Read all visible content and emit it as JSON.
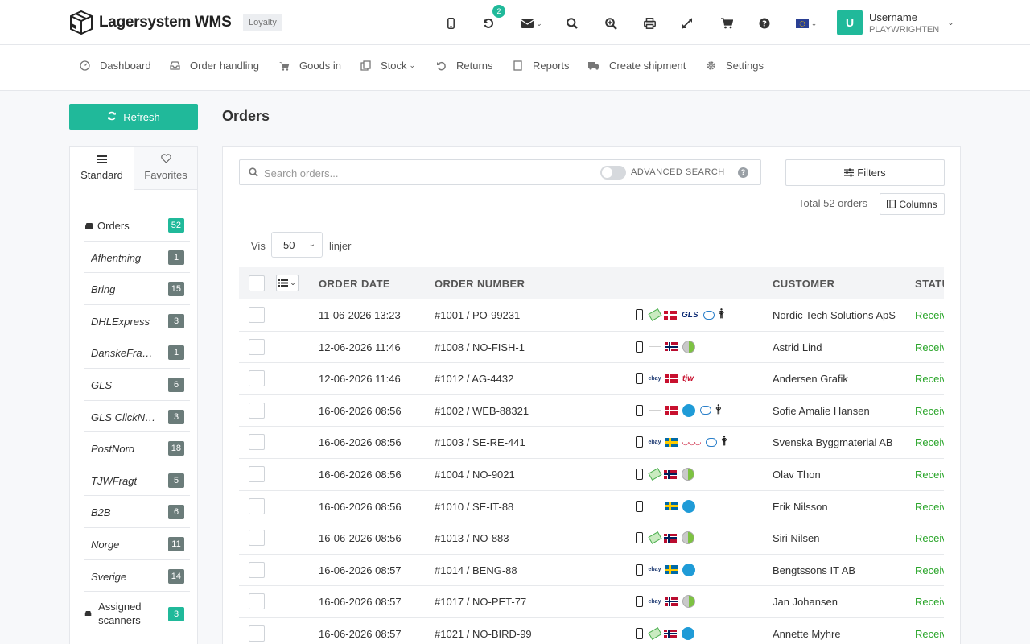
{
  "app": {
    "name": "Lagersystem WMS",
    "badge": "Loyalty"
  },
  "topbar": {
    "notification_count": "2",
    "user": {
      "initial": "U",
      "name": "Username",
      "account": "PLAYWRIGHTEN"
    }
  },
  "nav": [
    {
      "label": "Dashboard",
      "icon": "dashboard-icon"
    },
    {
      "label": "Order handling",
      "icon": "inbox-icon"
    },
    {
      "label": "Goods in",
      "icon": "cart-icon"
    },
    {
      "label": "Stock",
      "icon": "copy-icon"
    },
    {
      "label": "Returns",
      "icon": "undo-icon"
    },
    {
      "label": "Reports",
      "icon": "file-icon"
    },
    {
      "label": "Create shipment",
      "icon": "truck-icon"
    },
    {
      "label": "Settings",
      "icon": "gear-icon"
    }
  ],
  "sidebar": {
    "refresh_label": "Refresh",
    "tabs": {
      "standard": "Standard",
      "favorites": "Favorites"
    },
    "orders": {
      "label": "Orders",
      "count": "52"
    },
    "items": [
      {
        "label": "Afhentning",
        "count": "1"
      },
      {
        "label": "Bring",
        "count": "15"
      },
      {
        "label": "DHLExpress",
        "count": "3"
      },
      {
        "label": "DanskeFragtmænd",
        "count": "1"
      },
      {
        "label": "GLS",
        "count": "6"
      },
      {
        "label": "GLS ClickNShip",
        "count": "3"
      },
      {
        "label": "PostNord",
        "count": "18"
      },
      {
        "label": "TJWFragt",
        "count": "5"
      },
      {
        "label": "B2B",
        "count": "6"
      },
      {
        "label": "Norge",
        "count": "11"
      },
      {
        "label": "Sverige",
        "count": "14"
      }
    ],
    "assigned": {
      "label": "Assigned scanners",
      "count": "3"
    }
  },
  "main": {
    "title": "Orders",
    "search_placeholder": "Search orders...",
    "advanced_search": "ADVANCED SEARCH",
    "help": "?",
    "filters_label": "Filters",
    "total": "Total 52 orders",
    "columns_label": "Columns",
    "vis": "Vis",
    "per_page": "50",
    "linjer": "linjer"
  },
  "table": {
    "headers": {
      "date": "ORDER DATE",
      "number": "ORDER NUMBER",
      "customer": "CUSTOMER",
      "status": "STATUS"
    },
    "rows": [
      {
        "date": "11-06-2026 13:23",
        "number": "#1001 / PO-99231",
        "customer": "Nordic Tech Solutions ApS",
        "status": "Received",
        "icons": [
          "phone",
          "money",
          "dk",
          "gls",
          "comment",
          "person"
        ]
      },
      {
        "date": "12-06-2026 11:46",
        "number": "#1008 / NO-FISH-1",
        "customer": "Astrid Lind",
        "status": "Received",
        "icons": [
          "phone",
          "carrier-small",
          "no",
          "green"
        ]
      },
      {
        "date": "12-06-2026 11:46",
        "number": "#1012 / AG-4432",
        "customer": "Andersen Grafik",
        "status": "Received",
        "icons": [
          "phone",
          "carrier",
          "dk",
          "tjw"
        ]
      },
      {
        "date": "16-06-2026 08:56",
        "number": "#1002 / WEB-88321",
        "customer": "Sofie Amalie Hansen",
        "status": "Received",
        "icons": [
          "phone",
          "carrier-small",
          "dk",
          "blue",
          "comment",
          "person"
        ]
      },
      {
        "date": "16-06-2026 08:56",
        "number": "#1003 / SE-RE-441",
        "customer": "Svenska Byggmaterial AB",
        "status": "Received",
        "icons": [
          "phone",
          "carrier",
          "se",
          "dfm",
          "comment",
          "person"
        ]
      },
      {
        "date": "16-06-2026 08:56",
        "number": "#1004 / NO-9021",
        "customer": "Olav Thon",
        "status": "Received",
        "icons": [
          "phone",
          "money",
          "no",
          "green"
        ]
      },
      {
        "date": "16-06-2026 08:56",
        "number": "#1010 / SE-IT-88",
        "customer": "Erik Nilsson",
        "status": "Received",
        "icons": [
          "phone",
          "carrier-small",
          "se",
          "blue"
        ]
      },
      {
        "date": "16-06-2026 08:56",
        "number": "#1013 / NO-883",
        "customer": "Siri Nilsen",
        "status": "Received",
        "icons": [
          "phone",
          "money",
          "no",
          "green"
        ]
      },
      {
        "date": "16-06-2026 08:57",
        "number": "#1014 / BENG-88",
        "customer": "Bengtssons IT AB",
        "status": "Received",
        "icons": [
          "phone",
          "carrier",
          "se",
          "blue"
        ]
      },
      {
        "date": "16-06-2026 08:57",
        "number": "#1017 / NO-PET-77",
        "customer": "Jan Johansen",
        "status": "Received",
        "icons": [
          "phone",
          "carrier",
          "no",
          "green"
        ]
      },
      {
        "date": "16-06-2026 08:57",
        "number": "#1021 / NO-BIRD-99",
        "customer": "Annette Myhre",
        "status": "Received",
        "icons": [
          "phone",
          "money",
          "no",
          "blue"
        ]
      }
    ]
  },
  "colors": {
    "accent": "#20b99a",
    "status_green": "#2aa52a",
    "count_grey": "#6b7c7a"
  }
}
